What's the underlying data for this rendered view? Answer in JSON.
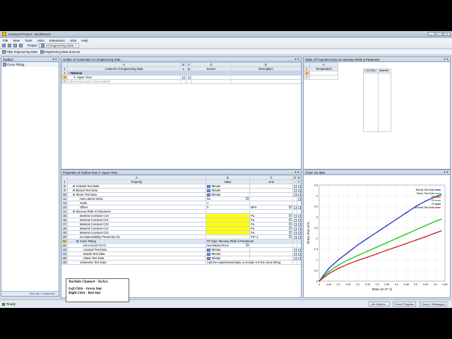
{
  "window": {
    "title": "Unsaved Project - Workbench",
    "controls": [
      "_",
      "□",
      "×"
    ]
  },
  "menu": [
    "File",
    "View",
    "Tools",
    "Units",
    "Extensions",
    "Jobs",
    "Help"
  ],
  "toolbar1": {
    "project_label": "Project",
    "tab_label": "A2:Engineering Data"
  },
  "toolbar2": {
    "filter_label": "Filter Engineering Data",
    "sources_label": "Engineering Data Sources"
  },
  "toolbox": {
    "title": "Toolbox",
    "item": "Curve Fitting",
    "footer": "View All / Customize..."
  },
  "outline": {
    "title": "Outline of Schematic A2: Engineering Data",
    "col_letters": [
      "A",
      "B",
      "C",
      "D",
      "E"
    ],
    "headers": [
      "Contents of Engineering Data",
      "",
      "",
      "Source",
      "Description"
    ],
    "row_numbers": [
      "1",
      "2",
      "3",
      "*"
    ],
    "material_label": "Material",
    "material_name": "Hyper Visor",
    "add_placeholder": "Click here to add a new material"
  },
  "table_props": {
    "title": "Table of Properties Row 16: Mooney-Rivlin 5 Parameter",
    "col_letter": "A",
    "header": "Temperature",
    "row_numbers": [
      "1",
      "2",
      "*"
    ],
    "inner_headers": [
      "C10 (Pa)",
      "Material"
    ]
  },
  "properties": {
    "title": "Properties of Outline Row 3: Hyper Visor",
    "col_letters": [
      "A",
      "B",
      "C",
      "D",
      "E"
    ],
    "headers": [
      "Property",
      "Value",
      "Unit",
      "",
      ""
    ],
    "rows": [
      {
        "n": "8",
        "name": "Uniaxial Test Data",
        "value": "Tabular",
        "unit": "",
        "indent": 1,
        "tab": true
      },
      {
        "n": "9",
        "name": "Biaxial Test Data",
        "value": "Tabular",
        "unit": "",
        "indent": 1,
        "tab": true
      },
      {
        "n": "10",
        "name": "Shear Test Data",
        "value": "Tabular",
        "unit": "",
        "indent": 1,
        "tab": true
      },
      {
        "n": "11",
        "name": "Has Lateral Strain",
        "value": "No",
        "unit": "",
        "indent": 3,
        "tab": false
      },
      {
        "n": "12",
        "name": "Scale",
        "value": "1",
        "unit": "",
        "indent": 3,
        "tab": false
      },
      {
        "n": "13",
        "name": "Offset",
        "value": "0",
        "unit": "MPa",
        "indent": 3,
        "tab": false
      },
      {
        "n": "14",
        "name": "Mooney-Rivlin 5 Parameter",
        "value": "",
        "unit": "",
        "indent": 1,
        "tab": false
      },
      {
        "n": "15",
        "name": "Material Constant C10",
        "value": "",
        "unit": "Pa",
        "indent": 3,
        "tab": false,
        "yellow": true
      },
      {
        "n": "16",
        "name": "Material Constant C01",
        "value": "",
        "unit": "Pa",
        "indent": 3,
        "tab": false,
        "yellow": true
      },
      {
        "n": "17",
        "name": "Material Constant C20",
        "value": "",
        "unit": "Pa",
        "indent": 3,
        "tab": false,
        "yellow": true
      },
      {
        "n": "18",
        "name": "Material Constant C11",
        "value": "",
        "unit": "Pa",
        "indent": 3,
        "tab": false,
        "yellow": true
      },
      {
        "n": "19",
        "name": "Material Constant C02",
        "value": "",
        "unit": "Pa",
        "indent": 3,
        "tab": false,
        "yellow": true
      },
      {
        "n": "20",
        "name": "Incompressibility Parameter D1",
        "value": "",
        "unit": "Pa^-1",
        "indent": 3,
        "tab": false
      },
      {
        "n": "21",
        "name": "Curve Fitting",
        "value": "Fit Type: Mooney-Rivlin 5 Parameter",
        "unit": "",
        "indent": 2,
        "tab": false,
        "selected": true
      },
      {
        "n": "22",
        "name": "Error Norm for Fit",
        "value": "Normalized Error",
        "unit": "",
        "indent": 4,
        "tab": false
      },
      {
        "n": "23",
        "name": "Uniaxial Test Data",
        "value": "Tabular",
        "unit": "",
        "indent": 4,
        "tab": true
      },
      {
        "n": "24",
        "name": "Biaxial Test Data",
        "value": "Tabular",
        "unit": "",
        "indent": 4,
        "tab": true
      },
      {
        "n": "25",
        "name": "Shear Test Data",
        "value": "Tabular",
        "unit": "",
        "indent": 4,
        "tab": true
      },
      {
        "n": "26",
        "name": "Volumetric Test Data",
        "value": "Add the experimental data, to include it in the curve fitting.",
        "unit": "",
        "indent": 3,
        "tab": false
      }
    ]
  },
  "chart_title": "Chart: No data",
  "chart_data": {
    "type": "line",
    "xlabel": "Strain (m m^-1)",
    "ylabel": "Stress (Pa) 10^6",
    "xlim": [
      0,
      0.65
    ],
    "ylim": [
      0,
      4.5
    ],
    "xticks": [
      "0",
      "0.05",
      "0.1",
      "0.15",
      "0.2",
      "0.25",
      "0.3",
      "0.35",
      "0.4",
      "0.45",
      "0.5",
      "0.55",
      "0.6",
      "0.65"
    ],
    "yticks": [
      "0",
      "0.5",
      "1",
      "1.5",
      "2",
      "2.5",
      "3",
      "3.5",
      "4",
      "4.5"
    ],
    "legend": [
      "Biaxial Test Data",
      "Shear Test Data",
      "Fit",
      "Fit",
      "Fit",
      "Uniaxial Test Data"
    ],
    "legend_position": "top-right",
    "series": [
      {
        "name": "Biaxial Test Data",
        "color": "#1f2fd1",
        "x": [
          0,
          0.05,
          0.1,
          0.15,
          0.2,
          0.25,
          0.3,
          0.35,
          0.4,
          0.45,
          0.5,
          0.55,
          0.6,
          0.63
        ],
        "y": [
          0,
          0.6,
          1.0,
          1.35,
          1.7,
          2.0,
          2.3,
          2.6,
          2.9,
          3.2,
          3.5,
          3.75,
          3.95,
          4.05
        ]
      },
      {
        "name": "Shear Test Data",
        "color": "#10c810",
        "x": [
          0,
          0.05,
          0.1,
          0.15,
          0.2,
          0.25,
          0.3,
          0.35,
          0.4,
          0.45,
          0.5,
          0.55,
          0.6,
          0.63
        ],
        "y": [
          0,
          0.45,
          0.75,
          1.0,
          1.2,
          1.4,
          1.6,
          1.8,
          2.0,
          2.2,
          2.4,
          2.6,
          2.8,
          2.9
        ]
      },
      {
        "name": "Uniaxial Test Data",
        "color": "#d11a1a",
        "x": [
          0,
          0.05,
          0.1,
          0.15,
          0.2,
          0.25,
          0.3,
          0.35,
          0.4,
          0.45,
          0.5,
          0.55,
          0.6,
          0.63
        ],
        "y": [
          0,
          0.35,
          0.6,
          0.8,
          0.97,
          1.12,
          1.28,
          1.45,
          1.6,
          1.76,
          1.92,
          2.08,
          2.25,
          2.35
        ]
      }
    ]
  },
  "status": {
    "text": "Ready",
    "buttons": [
      "Job Monitor...",
      "Show Progress",
      "Show 0 Messages"
    ]
  },
  "note": {
    "line1": "YouTube Channel - Tech.G",
    "line2": "Left Click  -  Green Star",
    "line3": "Right Click  -  Red Star"
  }
}
